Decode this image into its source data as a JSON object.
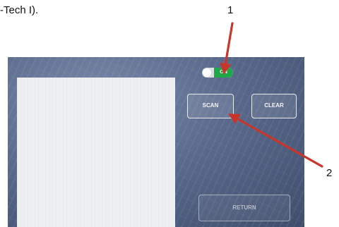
{
  "caption": "-Tech I).",
  "callouts": {
    "one": "1",
    "two": "2"
  },
  "device": {
    "toggle": {
      "label": "ON",
      "state": "on"
    },
    "buttons": {
      "scan": "SCAN",
      "clear": "CLEAR",
      "return": "RETURN"
    }
  },
  "colors": {
    "arrow": "#c8362b",
    "toggle_on": "#1fa84a",
    "screen_bg": "#5a6a8c"
  }
}
